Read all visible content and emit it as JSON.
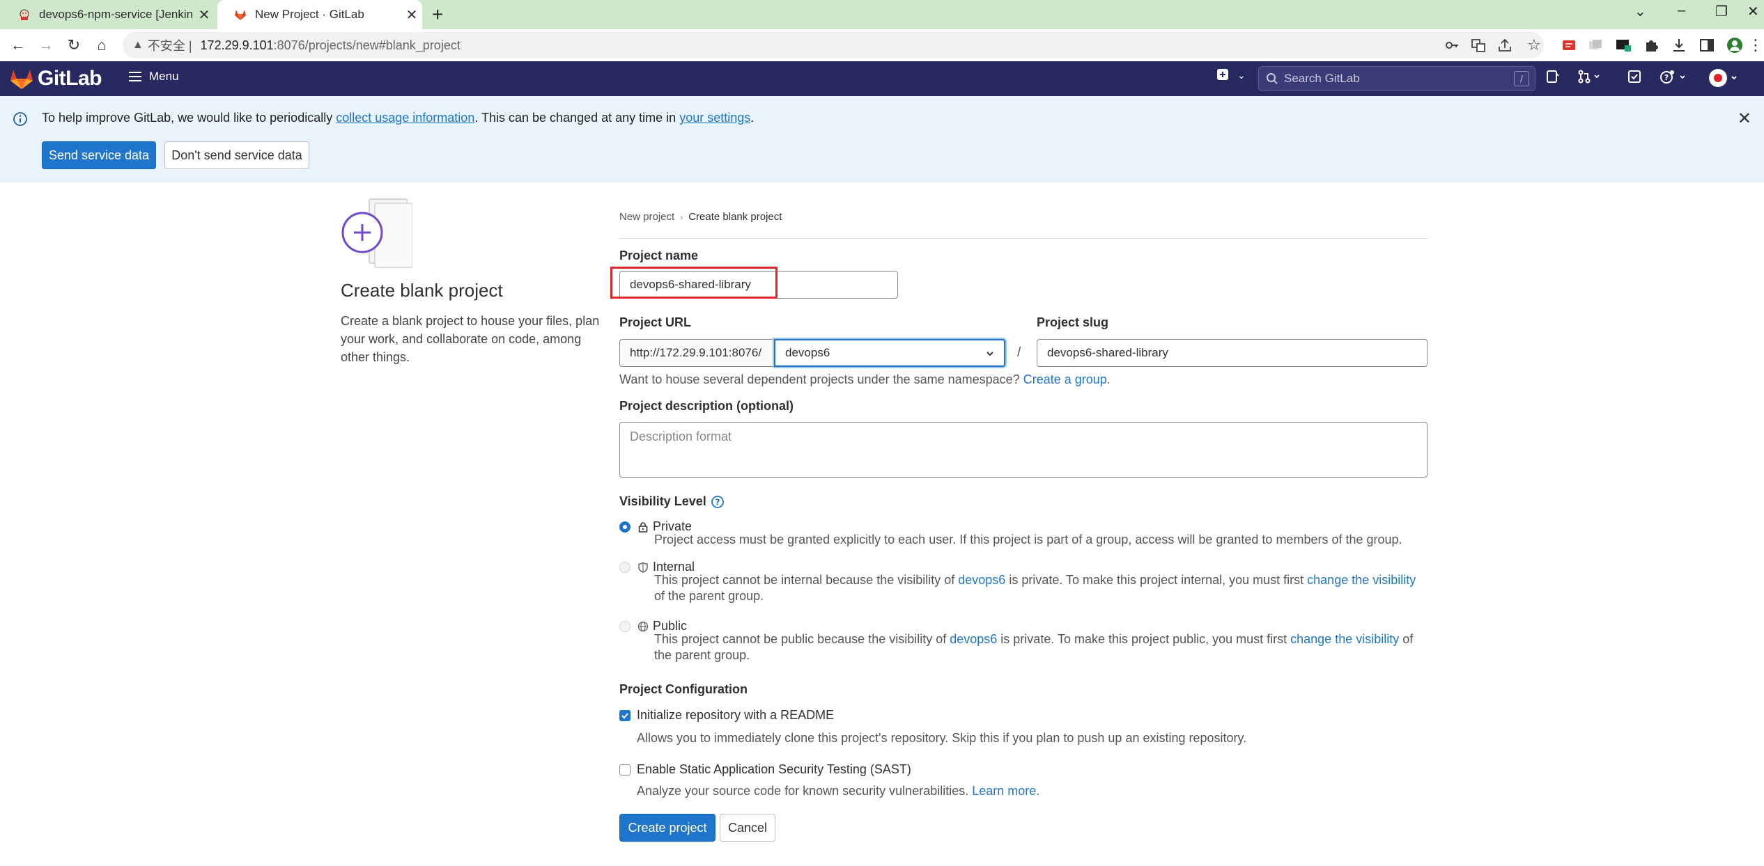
{
  "browser": {
    "tabs": [
      {
        "title": "devops6-npm-service [Jenkins]",
        "active": false
      },
      {
        "title": "New Project · GitLab",
        "active": true
      }
    ],
    "address": {
      "security_label": "不安全",
      "separator": "|",
      "host": "172.29.9.101",
      "path": ":8076/projects/new#blank_project"
    }
  },
  "gitlab_nav": {
    "brand": "GitLab",
    "menu_label": "Menu",
    "search_placeholder": "Search GitLab",
    "search_shortcut": "/"
  },
  "banner": {
    "text_before": "To help improve GitLab, we would like to periodically ",
    "link1": "collect usage information",
    "text_middle": ". This can be changed at any time in ",
    "link2": "your settings",
    "text_after": ".",
    "send_button": "Send service data",
    "dont_send_button": "Don't send service data"
  },
  "left_panel": {
    "title": "Create blank project",
    "description": "Create a blank project to house your files, plan your work, and collaborate on code, among other things."
  },
  "breadcrumb": {
    "parent": "New project",
    "current": "Create blank project"
  },
  "form": {
    "project_name_label": "Project name",
    "project_name_value": "devops6-shared-library",
    "project_url_label": "Project URL",
    "url_prefix": "http://172.29.9.101:8076/",
    "namespace_value": "devops6",
    "url_separator": "/",
    "project_slug_label": "Project slug",
    "project_slug_value": "devops6-shared-library",
    "namespace_help_text": "Want to house several dependent projects under the same namespace? ",
    "namespace_help_link": "Create a group.",
    "description_label": "Project description (optional)",
    "description_placeholder": "Description format",
    "visibility_label": "Visibility Level",
    "visibility": {
      "private": {
        "title": "Private",
        "desc": "Project access must be granted explicitly to each user. If this project is part of a group, access will be granted to members of the group."
      },
      "internal": {
        "title": "Internal",
        "desc_before": "This project cannot be internal because the visibility of ",
        "desc_link1": "devops6",
        "desc_middle": " is private. To make this project internal, you must first ",
        "desc_link2": "change the visibility",
        "desc_after": " of the parent group."
      },
      "public": {
        "title": "Public",
        "desc_before": "This project cannot be public because the visibility of ",
        "desc_link1": "devops6",
        "desc_middle": " is private. To make this project public, you must first ",
        "desc_link2": "change the visibility",
        "desc_after": " of the parent group."
      }
    },
    "config_label": "Project Configuration",
    "readme_label": "Initialize repository with a README",
    "readme_help": "Allows you to immediately clone this project's repository. Skip this if you plan to push up an existing repository.",
    "sast_label": "Enable Static Application Security Testing (SAST)",
    "sast_help": "Analyze your source code for known security vulnerabilities. ",
    "sast_link": "Learn more.",
    "create_button": "Create project",
    "cancel_button": "Cancel"
  },
  "colors": {
    "nav_bg": "#292961",
    "primary": "#1f75cb",
    "banner_bg": "#e9f3fc",
    "highlight": "#e0242c"
  }
}
